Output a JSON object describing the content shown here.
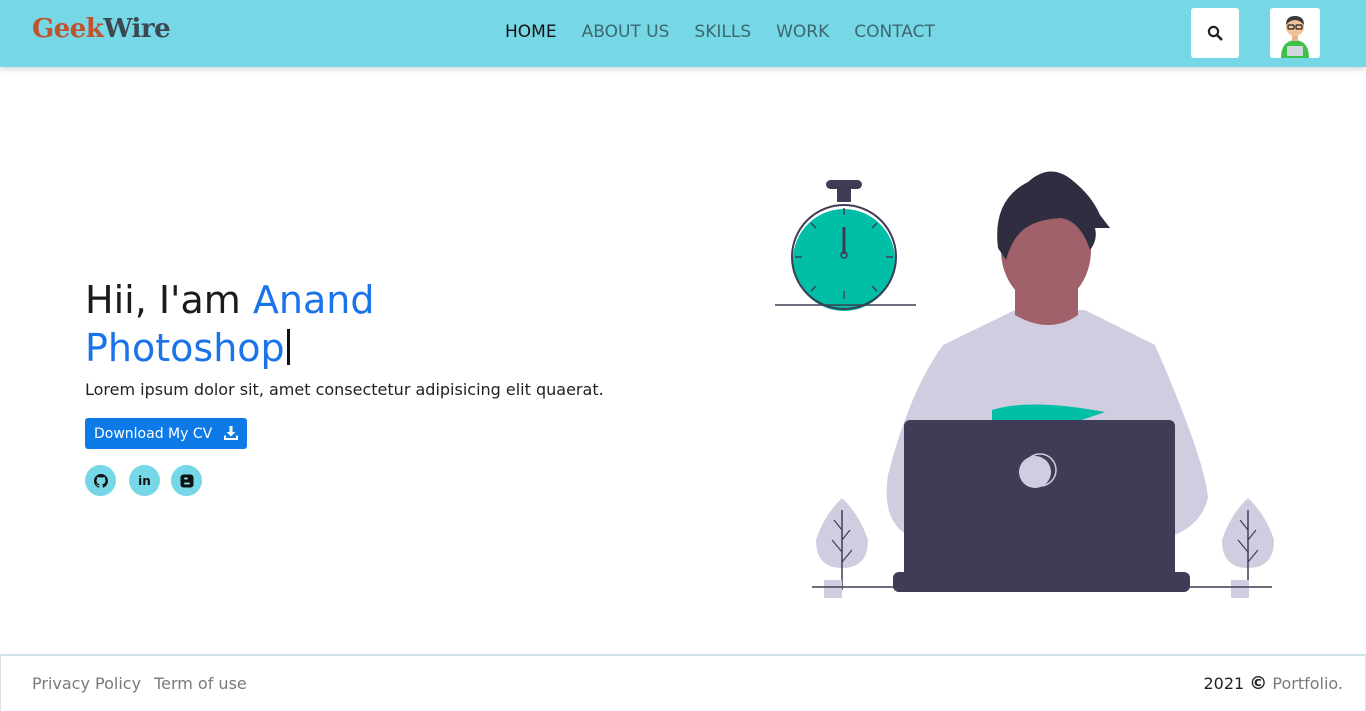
{
  "brand": {
    "part1": "Geek",
    "part2": "Wire"
  },
  "nav": {
    "items": [
      {
        "label": "HOME",
        "active": true
      },
      {
        "label": "ABOUT US",
        "active": false
      },
      {
        "label": "SKILLS",
        "active": false
      },
      {
        "label": "WORK",
        "active": false
      },
      {
        "label": "CONTACT",
        "active": false
      }
    ],
    "search_icon": "search-icon",
    "avatar_icon": "avatar-icon"
  },
  "hero": {
    "greeting": "Hii, I'am ",
    "name": "Anand",
    "typed_word": "Photoshop",
    "description": "Lorem ipsum dolor sit, amet consectetur adipisicing elit quaerat.",
    "cv_button": "Download My CV",
    "cv_icon": "download-icon",
    "socials": [
      {
        "icon": "github-icon",
        "glyph": ""
      },
      {
        "icon": "linkedin-icon",
        "glyph": "in"
      },
      {
        "icon": "blogger-icon",
        "glyph": "B"
      }
    ]
  },
  "footer": {
    "links": [
      "Privacy Policy",
      "Term of use"
    ],
    "year": "2021",
    "copyright_symbol": "©",
    "site": "Portfolio."
  },
  "colors": {
    "navbar": "#76d7e7",
    "accent_blue": "#1a73e8",
    "button_blue": "#0d7ae8",
    "illustration_teal": "#00bfa6",
    "illustration_dark": "#3f3d56"
  }
}
